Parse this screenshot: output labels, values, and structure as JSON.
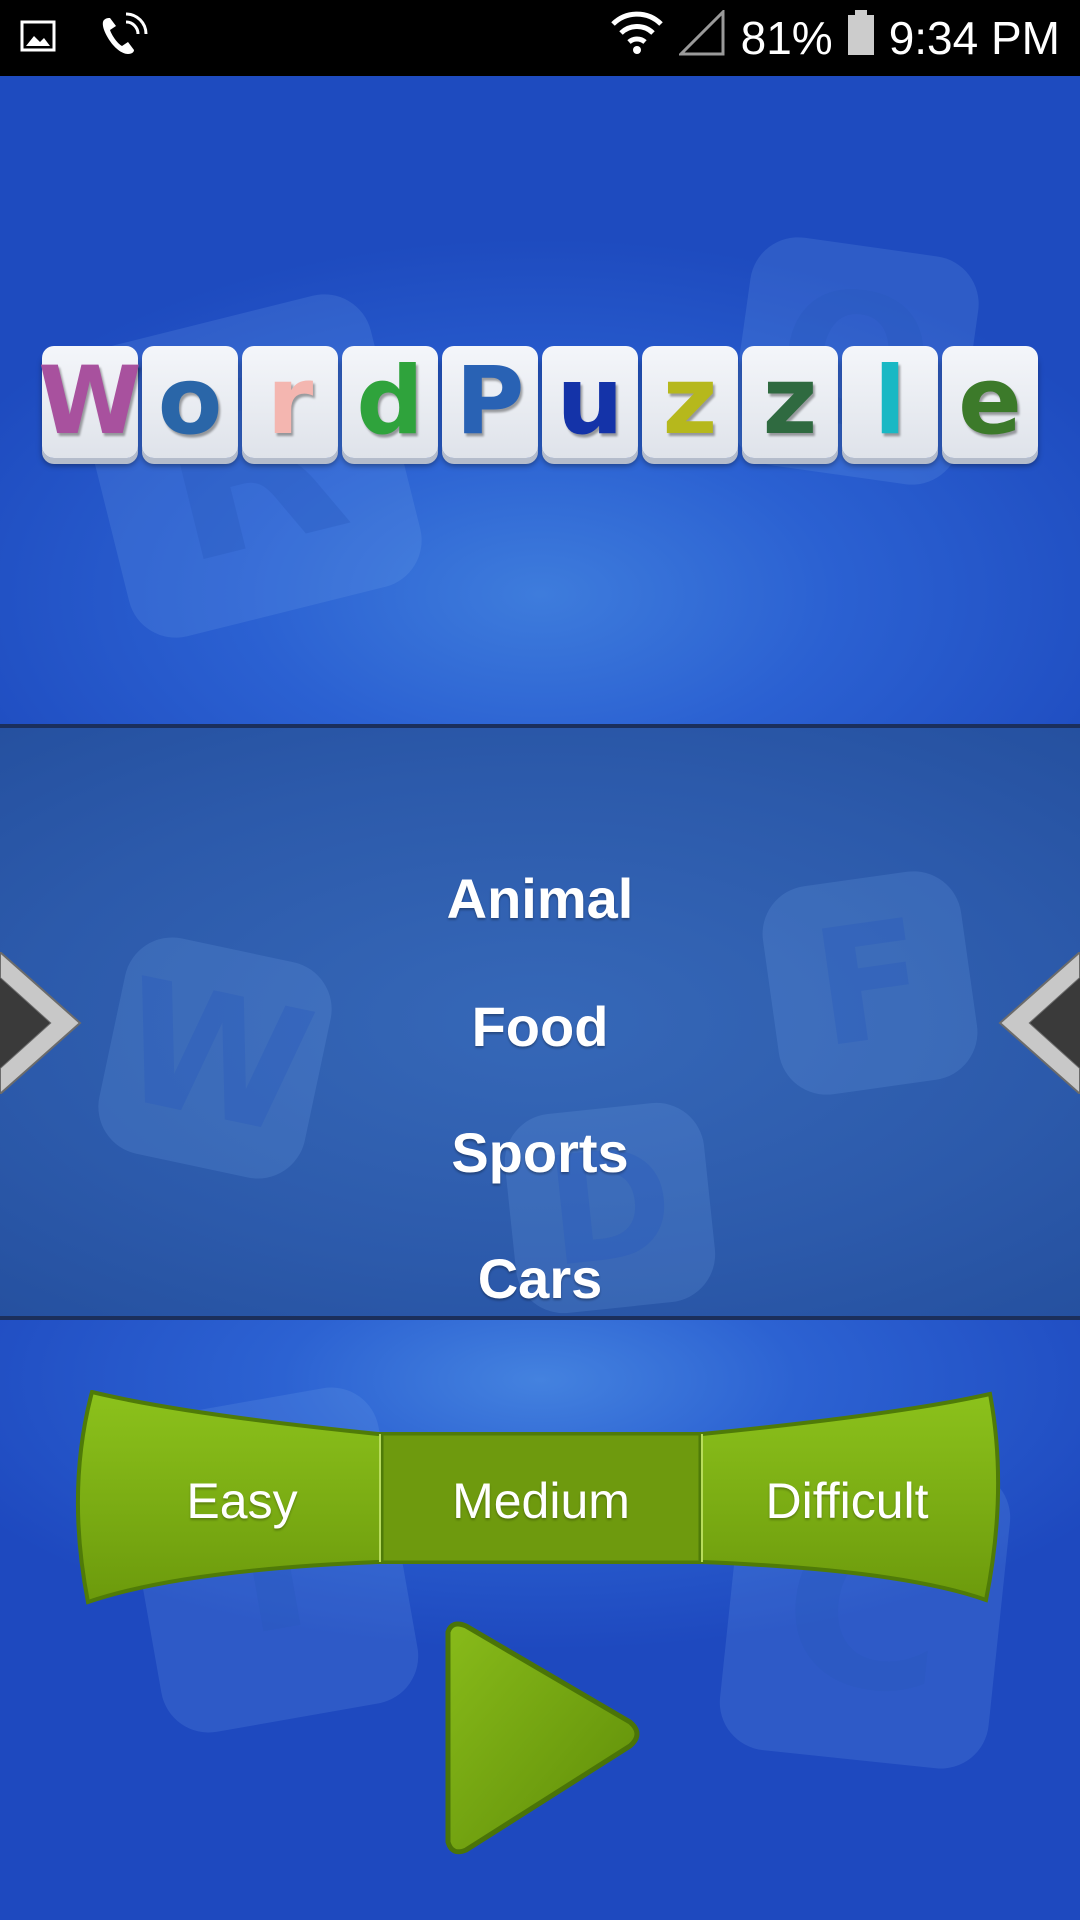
{
  "status_bar": {
    "battery": "81%",
    "time": "9:34 PM",
    "icons": [
      "image-icon",
      "wifi-call-icon",
      "wifi-icon",
      "signal-icon",
      "battery-icon"
    ]
  },
  "title": {
    "letters": [
      {
        "char": "W",
        "color": "#a8519e"
      },
      {
        "char": "o",
        "color": "#2a66a8"
      },
      {
        "char": "r",
        "color": "#f4b6b0"
      },
      {
        "char": "d",
        "color": "#2fa33c"
      },
      {
        "char": "P",
        "color": "#2962b4"
      },
      {
        "char": "u",
        "color": "#1433a8"
      },
      {
        "char": "z",
        "color": "#b6b81c"
      },
      {
        "char": "z",
        "color": "#2f6a40"
      },
      {
        "char": "l",
        "color": "#19b8c4"
      },
      {
        "char": "e",
        "color": "#3c7a2a"
      }
    ]
  },
  "categories": {
    "items": [
      "Animal",
      "Food",
      "Sports",
      "Cars"
    ],
    "prev_icon": "chevron-right-icon",
    "next_icon": "chevron-left-icon"
  },
  "difficulty": {
    "options": [
      "Easy",
      "Medium",
      "Difficult"
    ],
    "selected": "Medium",
    "colors": {
      "normal": "#7cad12",
      "selected": "#6e9a0e",
      "edge": "#4f7b08"
    }
  },
  "play_button": {
    "icon": "play-icon",
    "color": "#74a50e"
  }
}
